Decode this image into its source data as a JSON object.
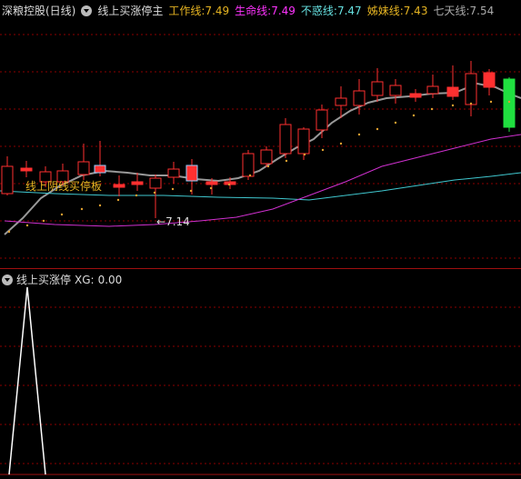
{
  "header": {
    "stock": "深粮控股(日线)",
    "indicator": "线上买涨停主",
    "lines": [
      {
        "label": "工作线:",
        "value": "7.49",
        "color": "#e6b422"
      },
      {
        "label": "生命线:",
        "value": "7.49",
        "color": "#ff33ff"
      },
      {
        "label": "不惑线:",
        "value": "7.47",
        "color": "#66e0e0"
      },
      {
        "label": "姊妹线:",
        "value": "7.43",
        "color": "#e6b422"
      },
      {
        "label": "七天线:",
        "value": "7.54",
        "color": "#aaaaaa"
      }
    ]
  },
  "annotations": {
    "signal_text": "线上阴线买停板",
    "low_marker": "7.14"
  },
  "sub": {
    "title": "线上买涨停",
    "xg_label": "XG:",
    "xg_value": "0.00"
  },
  "colors": {
    "up": "#ff3030",
    "down_fill": "#ff3030",
    "green": "#20e040",
    "grid": "#8b0000",
    "sma": "#999999",
    "cyan": "#40c8d0",
    "magenta": "#d030d0",
    "dots": "#e0a030"
  }
}
